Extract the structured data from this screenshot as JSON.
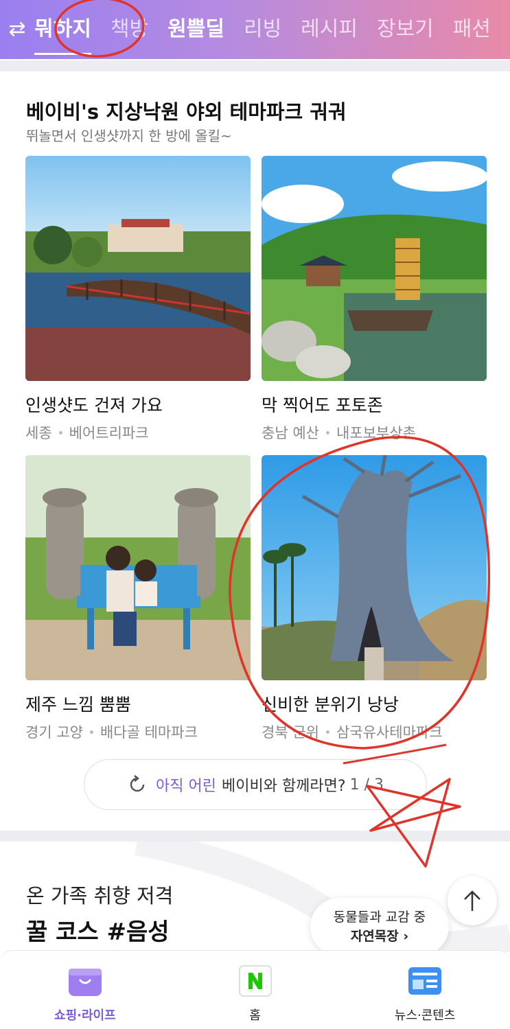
{
  "top_nav": {
    "tabs": [
      {
        "label": "뭐하지"
      },
      {
        "label": "책방"
      },
      {
        "label": "원쁠딜"
      },
      {
        "label": "리빙"
      },
      {
        "label": "레시피"
      },
      {
        "label": "장보기"
      },
      {
        "label": "패션"
      }
    ]
  },
  "section": {
    "title": "베이비's 지상낙원 야외 테마파크 궈궈",
    "subtitle": "뛰놀면서 인생샷까지 한 방에 올킬~",
    "cards": [
      {
        "title": "인생샷도 건져 가요",
        "region": "세종",
        "place": "베어트리파크"
      },
      {
        "title": "막 찍어도 포토존",
        "region": "충남 예산",
        "place": "내포보부상촌"
      },
      {
        "title": "제주 느낌 뿜뿜",
        "region": "경기 고양",
        "place": "배다골 테마파크"
      },
      {
        "title": "신비한 분위기 낭낭",
        "region": "경북 군위",
        "place": "삼국유사테마파크"
      }
    ],
    "more": {
      "accent": "아직 어린",
      "label": "베이비와 함께라면?",
      "page": "1 / 3"
    }
  },
  "section2": {
    "line1": "온 가족 취향 저격",
    "line2": "꿀 코스 #음성",
    "pill_line1": "동물들과 교감 중",
    "pill_line2": "자연목장 ›"
  },
  "bottom_nav": {
    "items": [
      {
        "label": "쇼핑·라이프",
        "icon": "shopping-bag-icon"
      },
      {
        "label": "홈",
        "icon": "naver-n-icon"
      },
      {
        "label": "뉴스·콘텐츠",
        "icon": "news-icon"
      }
    ]
  },
  "colors": {
    "accent": "#7b5cd6",
    "annotation": "#e0332a"
  }
}
